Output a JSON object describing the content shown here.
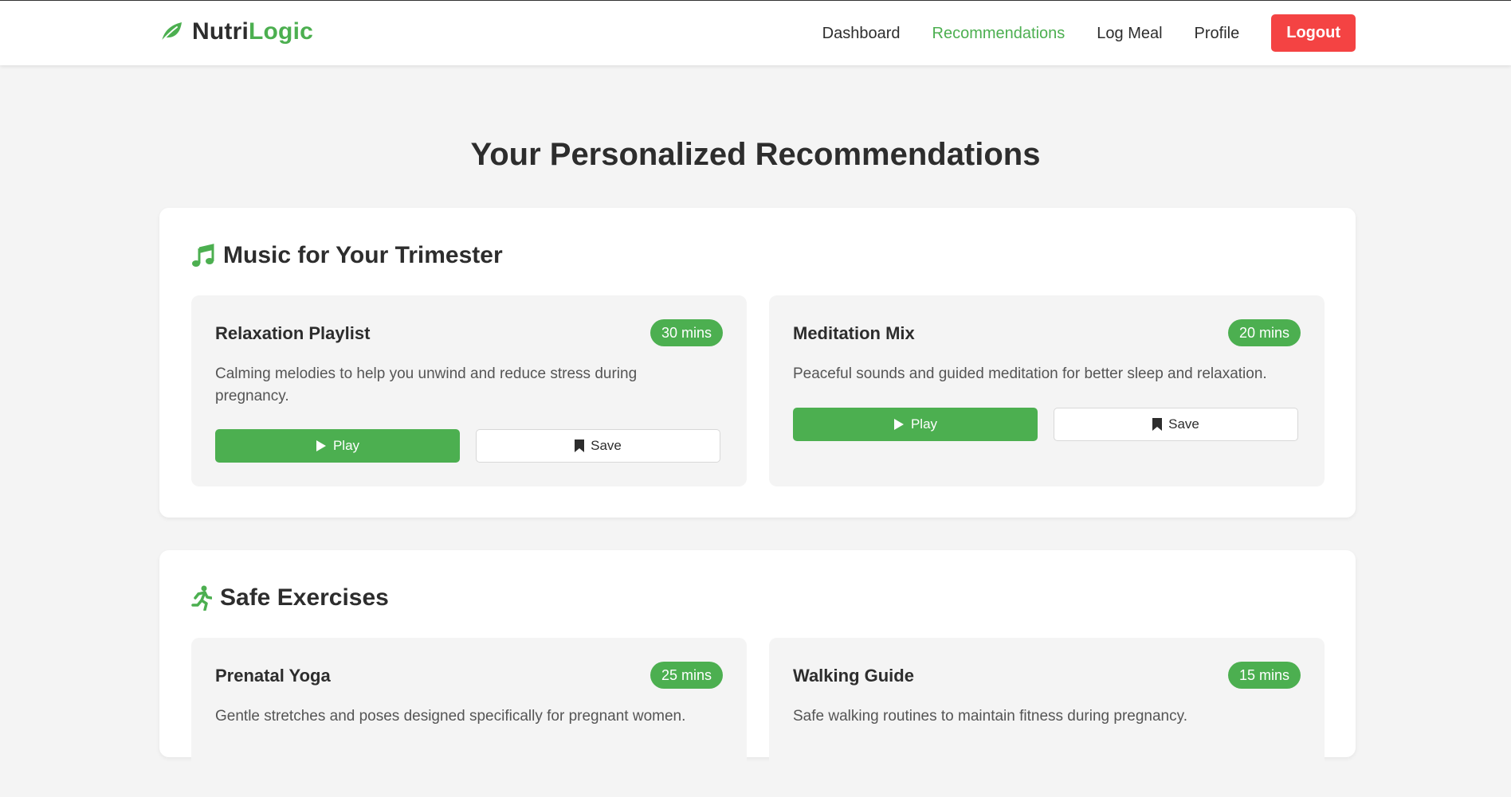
{
  "nav": {
    "brand_part1": "Nutri",
    "brand_part2": "Logic",
    "brand_icon": "leaf-icon",
    "links": [
      "Dashboard",
      "Recommendations",
      "Log Meal",
      "Profile"
    ],
    "active_link": "Recommendations",
    "logout_label": "Logout"
  },
  "page": {
    "title": "Your Personalized Recommendations"
  },
  "sections": [
    {
      "icon": "music-icon",
      "title": "Music for Your Trimester",
      "cards": [
        {
          "title": "Relaxation Playlist",
          "duration": "30 mins",
          "description": "Calming melodies to help you unwind and reduce stress during pregnancy.",
          "play_label": "Play",
          "save_label": "Save"
        },
        {
          "title": "Meditation Mix",
          "duration": "20 mins",
          "description": "Peaceful sounds and guided meditation for better sleep and relaxation.",
          "play_label": "Play",
          "save_label": "Save"
        }
      ]
    },
    {
      "icon": "running-icon",
      "title": "Safe Exercises",
      "cards": [
        {
          "title": "Prenatal Yoga",
          "duration": "25 mins",
          "description": "Gentle stretches and poses designed specifically for pregnant women."
        },
        {
          "title": "Walking Guide",
          "duration": "15 mins",
          "description": "Safe walking routines to maintain fitness during pregnancy."
        }
      ]
    }
  ],
  "colors": {
    "accent": "#4caf50",
    "logout": "#f44343",
    "background": "#f4f4f4",
    "text": "#2d2d2d"
  }
}
